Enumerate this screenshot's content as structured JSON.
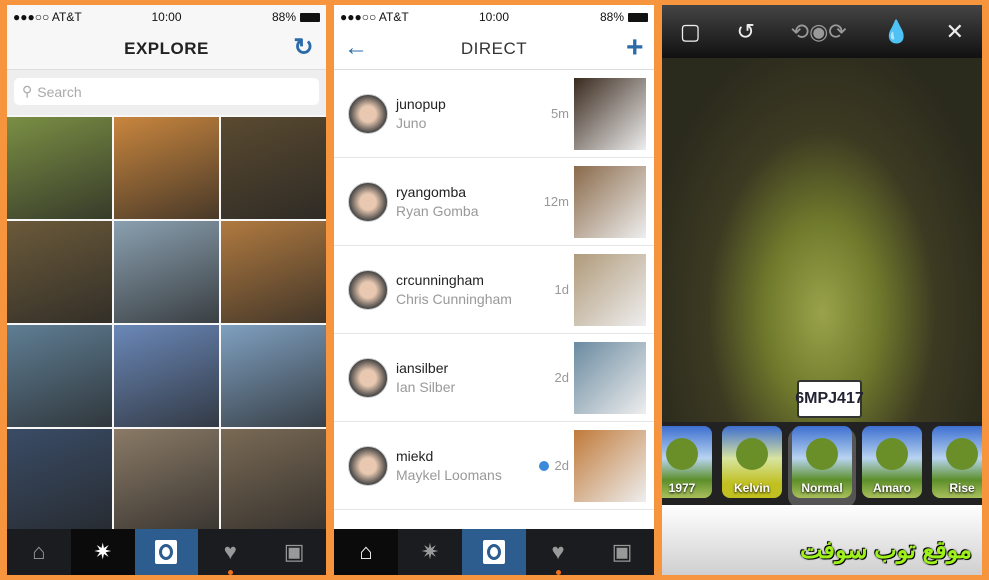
{
  "status": {
    "carrier": "●●●○○ AT&T",
    "time": "10:00",
    "battery": "88%"
  },
  "explore": {
    "title": "EXPLORE",
    "refresh_icon": "refresh-icon",
    "search_placeholder": "Search",
    "tiles": [
      "#7b8f44",
      "#c9863e",
      "#5a4a30",
      "#6b5a3a",
      "#8aa0b0",
      "#b07a40",
      "#5f7e94",
      "#6a88b8",
      "#7fa0c0",
      "#3a4c66",
      "#8a7a66",
      "#7a6a55"
    ]
  },
  "direct": {
    "title": "DIRECT",
    "back_icon": "arrow-left-icon",
    "add_icon": "plus-icon",
    "threads": [
      {
        "username": "junopup",
        "name": "Juno",
        "time": "5m",
        "unread": false,
        "thumb": "#3a2a1e"
      },
      {
        "username": "ryangomba",
        "name": "Ryan Gomba",
        "time": "12m",
        "unread": false,
        "thumb": "#8a6a4a"
      },
      {
        "username": "crcunningham",
        "name": "Chris Cunningham",
        "time": "1d",
        "unread": false,
        "thumb": "#b09a7a"
      },
      {
        "username": "iansilber",
        "name": "Ian Silber",
        "time": "2d",
        "unread": false,
        "thumb": "#6a8aa0"
      },
      {
        "username": "miekd",
        "name": "Maykel Loomans",
        "time": "2d",
        "unread": true,
        "thumb": "#c07a3a"
      }
    ]
  },
  "editor": {
    "filters": [
      "1977",
      "Kelvin",
      "Normal",
      "Amaro",
      "Rise"
    ],
    "selected_filter": "Normal",
    "plate": "6MPJ417",
    "watermark": "موقع توب سوفت"
  },
  "colors": {
    "accent": "#2d6aa8",
    "background": "#f7953f"
  }
}
